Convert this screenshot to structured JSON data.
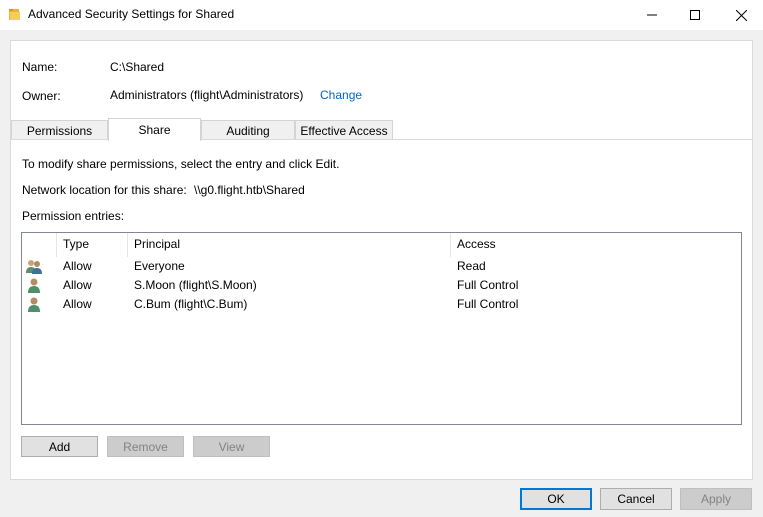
{
  "window": {
    "title": "Advanced Security Settings for Shared",
    "icon": "folder-icon",
    "controls": [
      "minimize-icon",
      "maximize-icon",
      "close-icon"
    ]
  },
  "info": {
    "name_label": "Name:",
    "name_value": "C:\\Shared",
    "owner_label": "Owner:",
    "owner_value": "Administrators (flight\\Administrators)",
    "change_link": "Change"
  },
  "tabs": [
    {
      "label": "Permissions",
      "active": false
    },
    {
      "label": "Share",
      "active": true
    },
    {
      "label": "Auditing",
      "active": false
    },
    {
      "label": "Effective Access",
      "active": false
    }
  ],
  "share": {
    "instruction": "To modify share permissions, select the entry and click Edit.",
    "network_label": "Network location for this share:",
    "network_value": "\\\\g0.flight.htb\\Shared",
    "entries_label": "Permission entries:"
  },
  "table": {
    "columns": [
      "Type",
      "Principal",
      "Access"
    ],
    "rows": [
      {
        "icon": "user-group-icon",
        "type": "Allow",
        "principal": "Everyone",
        "access": "Read"
      },
      {
        "icon": "user-icon",
        "type": "Allow",
        "principal": "S.Moon (flight\\S.Moon)",
        "access": "Full Control"
      },
      {
        "icon": "user-icon",
        "type": "Allow",
        "principal": "C.Bum (flight\\C.Bum)",
        "access": "Full Control"
      }
    ]
  },
  "actions": {
    "add": "Add",
    "remove": "Remove",
    "view": "View"
  },
  "footer": {
    "ok": "OK",
    "cancel": "Cancel",
    "apply": "Apply"
  },
  "colors": {
    "link": "#0066cc",
    "accent": "#0078d7",
    "window_bg": "#f0f0f0"
  }
}
